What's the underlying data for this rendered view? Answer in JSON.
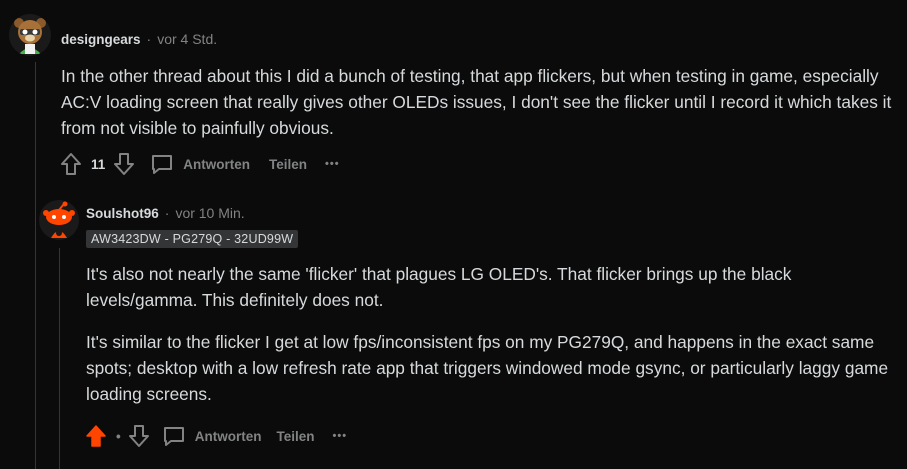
{
  "comment1": {
    "username": "designgears",
    "separator": "·",
    "timestamp": "vor 4 Std.",
    "text": "In the other thread about this I did a bunch of testing, that app flickers, but when testing in game, especially AC:V loading screen that really gives other OLEDs issues, I don't see the flicker until I record it which takes it from not visible to painfully obvious.",
    "vote_count": "11",
    "reply_label": "Antworten",
    "share_label": "Teilen",
    "more_label": "•••"
  },
  "comment2": {
    "username": "Soulshot96",
    "separator": "·",
    "timestamp": "vor 10 Min.",
    "flair": "AW3423DW - PG279Q - 32UD99W",
    "paragraphs": [
      "It's also not nearly the same 'flicker' that plagues LG OLED's. That flicker brings up the black levels/gamma. This definitely does not.",
      "It's similar to the flicker I get at low fps/inconsistent fps on my PG279Q, and happens in the exact same spots; desktop with a low refresh rate app that triggers windowed mode gsync, or particularly laggy game loading screens."
    ],
    "vote_count": "•",
    "reply_label": "Antworten",
    "share_label": "Teilen",
    "more_label": "•••",
    "upvote_color": "#ff4500"
  }
}
